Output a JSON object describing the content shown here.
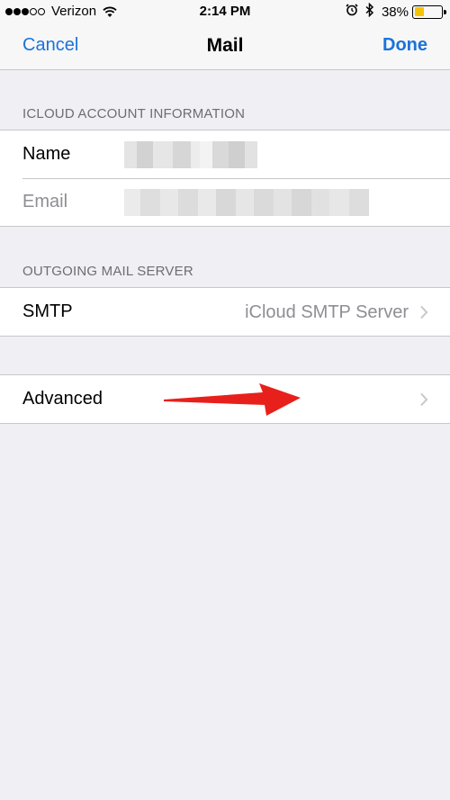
{
  "status_bar": {
    "carrier": "Verizon",
    "time": "2:14 PM",
    "battery_percent": "38%",
    "battery_level": 0.38
  },
  "nav": {
    "cancel_label": "Cancel",
    "title": "Mail",
    "done_label": "Done"
  },
  "icloud_section": {
    "header": "ICLOUD ACCOUNT INFORMATION",
    "rows": [
      {
        "label": "Name",
        "value_redacted": true
      },
      {
        "label": "Email",
        "value_redacted": true
      }
    ]
  },
  "outgoing_section": {
    "header": "OUTGOING MAIL SERVER",
    "smtp": {
      "label": "SMTP",
      "value": "iCloud SMTP Server"
    }
  },
  "advanced": {
    "label": "Advanced"
  },
  "colors": {
    "tint": "#1a73d9",
    "background": "#efeff4",
    "annotation_arrow": "#e8201b"
  }
}
